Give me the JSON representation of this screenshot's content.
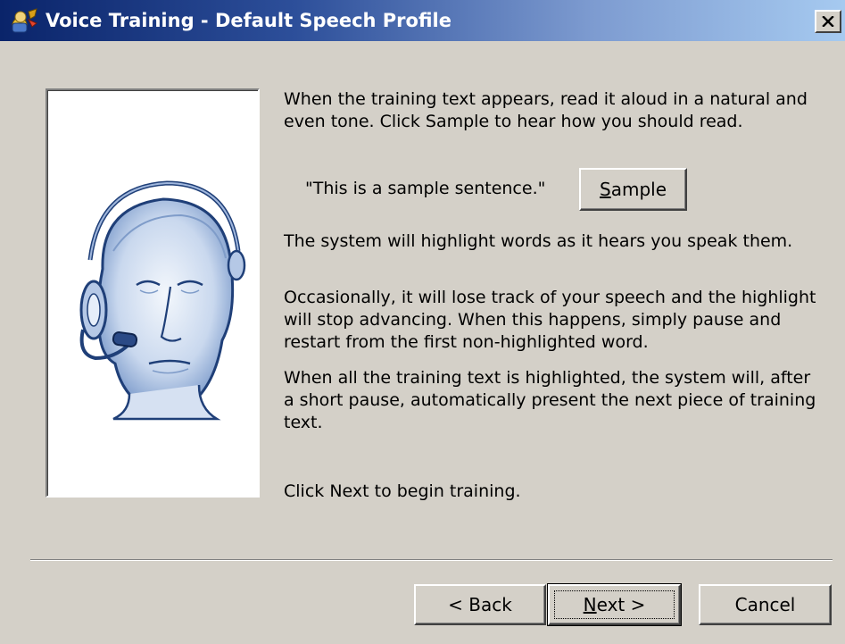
{
  "window": {
    "title": "Voice Training - Default Speech Profile",
    "icon": "speech-training-icon",
    "close_label": "✕"
  },
  "instructions": {
    "intro": "When the training text appears, read it aloud in a natural and even tone. Click Sample to hear how you should read.",
    "sample_sentence": "\"This is a sample sentence.\"",
    "highlight_info": "The system will highlight words as it hears you speak them.",
    "lose_track_info": "Occasionally, it will lose track of your speech and the highlight will stop advancing. When this happens, simply pause and restart from the first non-highlighted word.",
    "auto_present_info": "When all the training text is highlighted, the system will, after a short pause, automatically present the next piece of training text.",
    "begin_prompt": "Click Next to begin training."
  },
  "buttons": {
    "sample_label": "Sample",
    "back_label": "< Back",
    "next_label": "Next >",
    "cancel_label": "Cancel"
  },
  "illustration": {
    "icon": "headset-head-illustration",
    "colors": {
      "outline": "#1f3f78",
      "fill": "#c9d8ee",
      "shade": "#7f9cc9"
    }
  },
  "colors": {
    "titlebar_start": "#0a246a",
    "titlebar_end": "#a6caf0",
    "face": "#d4d0c8"
  }
}
